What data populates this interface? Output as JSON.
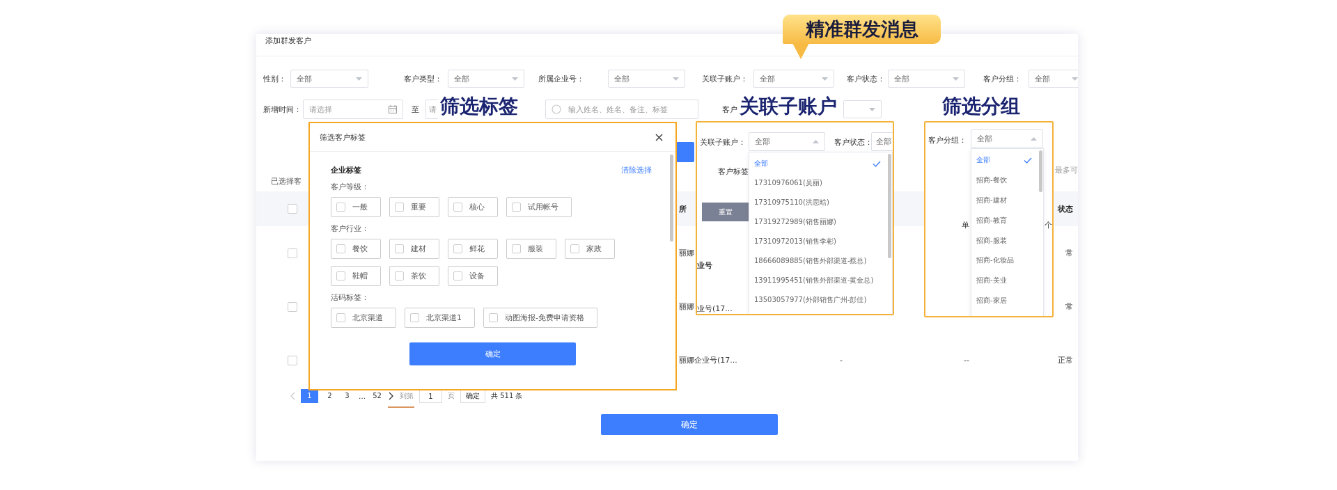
{
  "page_title": "添加群发客户",
  "callout_badge": "精准群发消息",
  "filters": [
    {
      "label": "性别：",
      "value": "全部"
    },
    {
      "label": "客户类型：",
      "value": "全部"
    },
    {
      "label": "所属企业号：",
      "value": "全部"
    },
    {
      "label": "关联子账户：",
      "value": "全部"
    },
    {
      "label": "客户状态：",
      "value": "全部"
    },
    {
      "label": "客户分组：",
      "value": "全部"
    }
  ],
  "filters_row2": {
    "date_label": "新增时间：",
    "date_start": {
      "placeholder": "请选择"
    },
    "separator": "至",
    "date_end": {
      "placeholder": "请"
    },
    "search": {
      "placeholder": "输入姓名、姓名、备注、标签"
    },
    "tag_label": "客户"
  },
  "selected_info": "已选择客",
  "limit_hint": "最多可",
  "table": {
    "header": {
      "checked": false,
      "company": "所",
      "status": "状态"
    },
    "rows": [
      {
        "checked": false,
        "company": "丽娜",
        "status": "常"
      },
      {
        "checked": false,
        "company": "丽娜",
        "status": "常"
      },
      {
        "checked": false,
        "company": "丽娜企业号(17...",
        "column_3": "-",
        "column_4": "--",
        "status": "正常"
      }
    ]
  },
  "pagination": {
    "prev": {
      "disabled": true
    },
    "pages": [
      {
        "kind": "page",
        "label": "1",
        "selected": true
      },
      {
        "kind": "page",
        "label": "2",
        "selected": false
      },
      {
        "kind": "page",
        "label": "3",
        "selected": false
      },
      {
        "kind": "ellipsis",
        "label": "…"
      },
      {
        "kind": "page",
        "label": "52",
        "selected": false
      }
    ],
    "next": {
      "disabled": false
    },
    "goto_label": "到第",
    "goto_value": "1",
    "page_unit": "页",
    "goto_button": "确定",
    "total": "共 511 条"
  },
  "confirm_button": "确定",
  "headings": {
    "tags": "筛选标签",
    "account": "关联子账户",
    "group": "筛选分组"
  },
  "tag_modal": {
    "title": "筛选客户标签",
    "section": "企业标签",
    "clear_link": "清除选择",
    "groups": [
      {
        "label": "客户等级：",
        "tags": [
          {
            "text": "一般",
            "checked": false
          },
          {
            "text": "重要",
            "checked": false
          },
          {
            "text": "核心",
            "checked": false
          },
          {
            "text": "试用帐号",
            "checked": false
          }
        ]
      },
      {
        "label": "客户行业：",
        "tags": [
          {
            "text": "餐饮",
            "checked": false
          },
          {
            "text": "建材",
            "checked": false
          },
          {
            "text": "鲜花",
            "checked": false
          },
          {
            "text": "服装",
            "checked": false
          },
          {
            "text": "家政",
            "checked": false
          },
          {
            "text": "鞋帽",
            "checked": false
          },
          {
            "text": "茶饮",
            "checked": false
          },
          {
            "text": "设备",
            "checked": false
          }
        ]
      },
      {
        "label": "活码标签：",
        "tags": [
          {
            "text": "北京渠道",
            "checked": false
          },
          {
            "text": "北京渠道1",
            "checked": false
          },
          {
            "text": "动图海报-免费申请资格",
            "checked": false
          }
        ]
      }
    ],
    "confirm_button": "确定"
  },
  "account_callout": {
    "label": "关联子账户：",
    "value": "全部",
    "status_label": "客户状态：",
    "status_value": "全部",
    "tag_label": "客户标签",
    "reset_button": "重置",
    "fragments": [
      "业号",
      "业号(17..."
    ],
    "options": [
      {
        "text": "全部",
        "selected": true
      },
      {
        "text": "17310976061(吴丽)",
        "selected": false
      },
      {
        "text": "17310975110(洪思晗)",
        "selected": false
      },
      {
        "text": "17319272989(销售丽娜)",
        "selected": false
      },
      {
        "text": "17310972013(销售李彬)",
        "selected": false
      },
      {
        "text": "18666089885(销售外部渠道-蔡总)",
        "selected": false
      },
      {
        "text": "13911995451(销售外部渠道-黄金总)",
        "selected": false
      },
      {
        "text": "13503057977(外部销售广州-彭佳)",
        "selected": false
      }
    ]
  },
  "group_callout": {
    "label": "客户分组：",
    "value": "全部",
    "fragments": [
      "单",
      "个"
    ],
    "options": [
      {
        "text": "全部",
        "selected": true
      },
      {
        "text": "招商-餐饮",
        "selected": false
      },
      {
        "text": "招商-建材",
        "selected": false
      },
      {
        "text": "招商-教育",
        "selected": false
      },
      {
        "text": "招商-服装",
        "selected": false
      },
      {
        "text": "招商-化妆品",
        "selected": false
      },
      {
        "text": "招商-美业",
        "selected": false
      },
      {
        "text": "招商-家居",
        "selected": false
      }
    ]
  }
}
